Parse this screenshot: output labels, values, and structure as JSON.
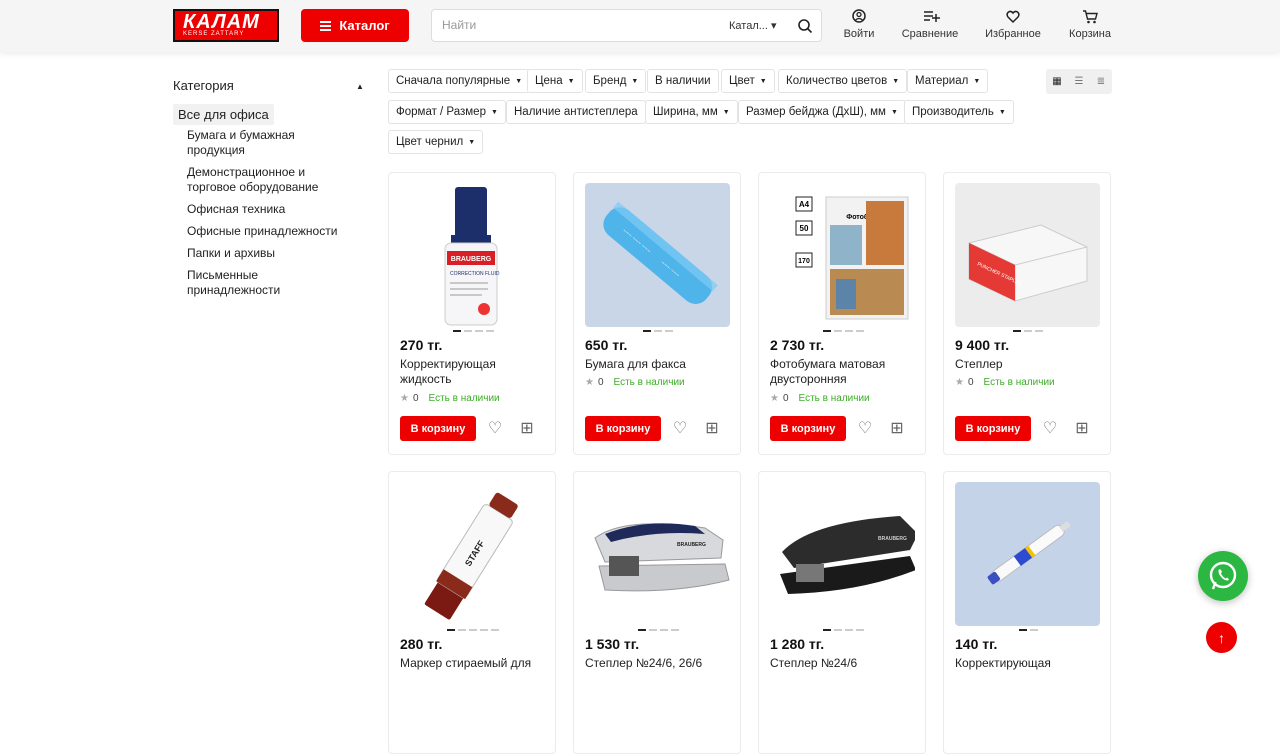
{
  "header": {
    "logo_text": "КАЛАМ",
    "logo_sub": "KERSE ZATTARY",
    "catalog_label": "Каталог",
    "search_placeholder": "Найти",
    "search_scope": "Катал...",
    "login": "Войти",
    "compare": "Сравнение",
    "favorites": "Избранное",
    "cart": "Корзина"
  },
  "sidebar": {
    "title": "Категория",
    "selected": "Все для офиса",
    "items": [
      "Бумага и бумажная продукция",
      "Демонстрационное и торговое оборудование",
      "Офисная техника",
      "Офисные принадлежности",
      "Папки и архивы",
      "Письменные принадлежности"
    ]
  },
  "filters": [
    "Сначала популярные",
    "Цена",
    "Бренд",
    "В наличии",
    "Цвет",
    "Количество цветов",
    "Материал",
    "Формат / Размер",
    "Наличие антистеплера",
    "Ширина, мм",
    "Размер бейджа (ДхШ), мм",
    "Производитель",
    "Цвет чернил"
  ],
  "products": [
    {
      "price": "270 тг.",
      "name": "Корректирующая жидкость",
      "rating": "0",
      "stock": "Есть в наличии"
    },
    {
      "price": "650 тг.",
      "name": "Бумага для факса",
      "rating": "0",
      "stock": "Есть в наличии"
    },
    {
      "price": "2 730 тг.",
      "name": "Фотобумага матовая двусторонняя",
      "rating": "0",
      "stock": "Есть в наличии"
    },
    {
      "price": "9 400 тг.",
      "name": "Степлер",
      "rating": "0",
      "stock": "Есть в наличии"
    },
    {
      "price": "280 тг.",
      "name": "Маркер стираемый для",
      "rating": "",
      "stock": ""
    },
    {
      "price": "1 530 тг.",
      "name": "Степлер №24/6, 26/6",
      "rating": "",
      "stock": ""
    },
    {
      "price": "1 280 тг.",
      "name": "Степлер №24/6",
      "rating": "",
      "stock": ""
    },
    {
      "price": "140 тг.",
      "name": "Корректирующая",
      "rating": "",
      "stock": ""
    }
  ],
  "buy_label": "В корзину",
  "image_labels": {
    "brauberg": "BRAUBERG",
    "correction": "CORRECTION FLUID",
    "photo_a4": "A4",
    "photo_50": "50",
    "photo_170": "170",
    "photo_title": "Фотобумага",
    "stapler_box": "PUNCHER STAPLER",
    "staff": "STAFF"
  },
  "colors": {
    "accent": "#ee0000",
    "stock": "#3bae26",
    "whatsapp": "#2bb741"
  }
}
